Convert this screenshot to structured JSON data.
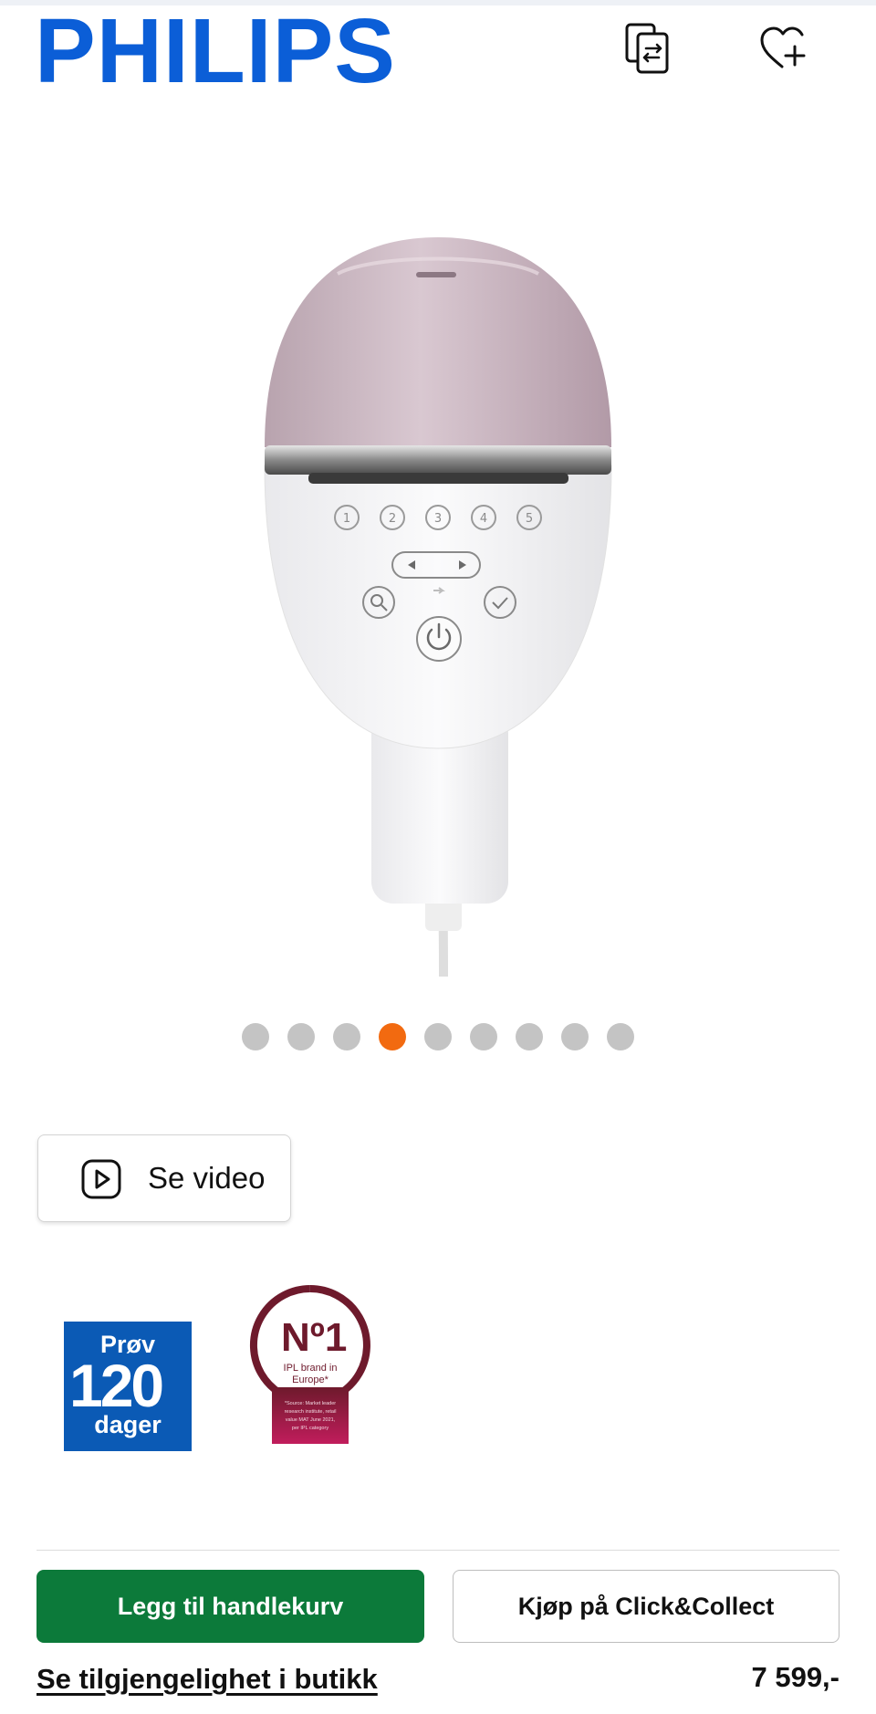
{
  "header": {
    "logo_text": "PHILIPS",
    "compare_icon": "compare-icon",
    "wishlist_icon": "heart-plus-icon"
  },
  "product_image": {
    "icon": "ipl-device-image",
    "panel_buttons": [
      "1",
      "2",
      "3",
      "4",
      "5"
    ]
  },
  "carousel": {
    "total": 9,
    "active_index": 3
  },
  "video_button": {
    "label": "Se video",
    "icon": "play-icon"
  },
  "badges": {
    "trial_top": "Prøv",
    "trial_number": "120",
    "trial_bottom": "dager",
    "no1_mark": "Nº1",
    "no1_text": "IPL brand in Europe*",
    "no1_source": "*Source: Market leader research institute, retail value MAT June 2021, per IPL category"
  },
  "actions": {
    "add_to_cart": "Legg til handlekurv",
    "click_collect": "Kjøp på Click&Collect",
    "availability_link": "Se tilgjengelighet i butikk",
    "price": "7 599,-"
  },
  "colors": {
    "brand_blue": "#0b5ed7",
    "cart_green": "#0c7a3a",
    "active_dot": "#f26a10",
    "inactive_dot": "#c4c4c4"
  }
}
